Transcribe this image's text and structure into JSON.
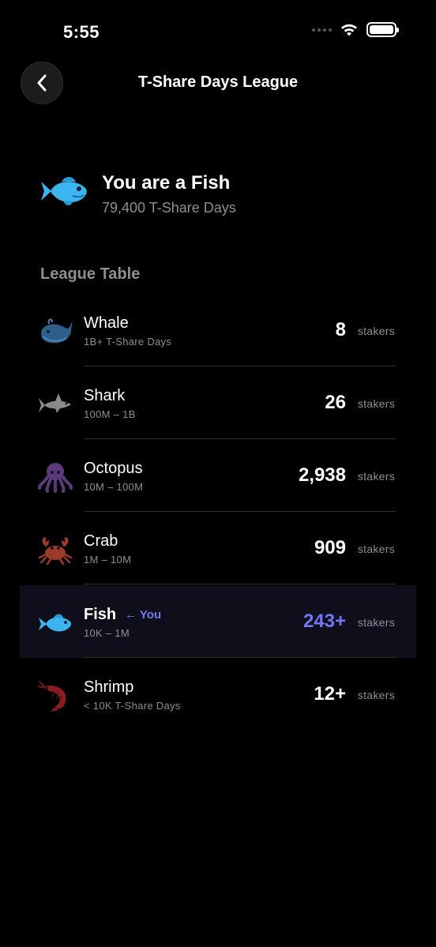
{
  "status_bar": {
    "time": "5:55"
  },
  "nav": {
    "title": "T-Share Days League",
    "back_icon": "chevron-left-icon"
  },
  "hero": {
    "icon": "fish-icon",
    "title": "You are a Fish",
    "subtitle": "79,400 T-Share Days"
  },
  "section": {
    "label": "League Table"
  },
  "colors": {
    "accent": "#7177f2",
    "whale": "#2d5f8a",
    "shark": "#8a8a8a",
    "octopus": "#5a3a78",
    "crab": "#9a3a2a",
    "fish": "#3bb4f0",
    "shrimp": "#8a1c22",
    "highlight_bg": "#0f0f1c"
  },
  "league": [
    {
      "icon": "whale-icon",
      "name": "Whale",
      "range": "1B+ T-Share Days",
      "count": "8",
      "unit": "stakers"
    },
    {
      "icon": "shark-icon",
      "name": "Shark",
      "range": "100M – 1B",
      "count": "26",
      "unit": "stakers"
    },
    {
      "icon": "octopus-icon",
      "name": "Octopus",
      "range": "10M – 100M",
      "count": "2,938",
      "unit": "stakers"
    },
    {
      "icon": "crab-icon",
      "name": "Crab",
      "range": "1M – 10M",
      "count": "909",
      "unit": "stakers"
    },
    {
      "icon": "fish-icon",
      "name": "Fish",
      "you_label": "← You",
      "range": "10K – 1M",
      "count": "243+",
      "unit": "stakers"
    },
    {
      "icon": "shrimp-icon",
      "name": "Shrimp",
      "range": "< 10K T-Share Days",
      "count": "12+",
      "unit": "stakers"
    }
  ]
}
